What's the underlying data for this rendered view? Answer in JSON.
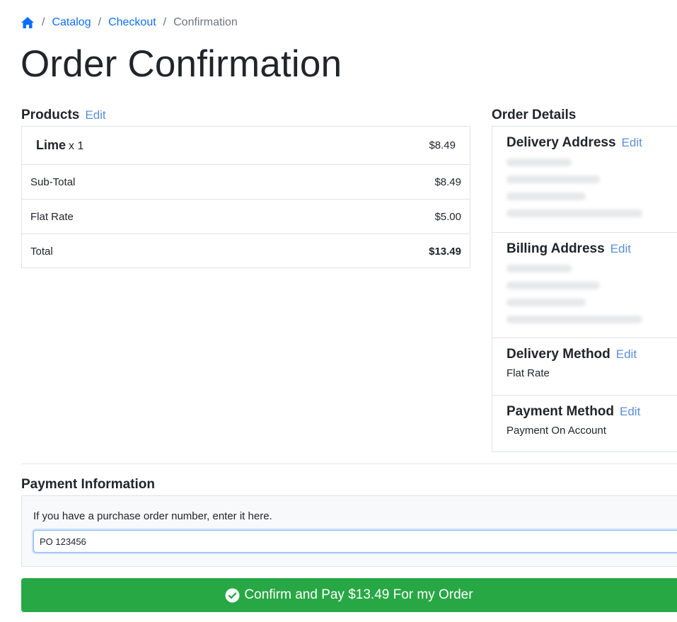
{
  "breadcrumb": {
    "home_icon": "house-icon",
    "separator": "/",
    "items": [
      {
        "label": "Catalog"
      },
      {
        "label": "Checkout"
      },
      {
        "label": "Confirmation"
      }
    ]
  },
  "page_title": "Order Confirmation",
  "products": {
    "heading": "Products",
    "edit_label": "Edit",
    "items": [
      {
        "name": "Lime",
        "qty": "x 1",
        "price": "$8.49"
      }
    ],
    "totals": [
      {
        "label": "Sub-Total",
        "value": "$8.49"
      },
      {
        "label": "Flat Rate",
        "value": "$5.00"
      },
      {
        "label": "Total",
        "value": "$13.49"
      }
    ]
  },
  "order_details": {
    "heading": "Order Details",
    "delivery_address": {
      "title": "Delivery Address",
      "edit_label": "Edit"
    },
    "billing_address": {
      "title": "Billing Address",
      "edit_label": "Edit"
    },
    "delivery_method": {
      "title": "Delivery Method",
      "edit_label": "Edit",
      "value": "Flat Rate"
    },
    "payment_method": {
      "title": "Payment Method",
      "edit_label": "Edit",
      "value": "Payment On Account"
    }
  },
  "payment_info": {
    "heading": "Payment Information",
    "po_label": "If you have a purchase order number, enter it here.",
    "po_value": "PO 123456"
  },
  "confirm_button": {
    "label": "Confirm and Pay $13.49 For my Order",
    "icon": "check-circle-icon"
  },
  "colors": {
    "link": "#0d6efd",
    "edit_link": "#5b8fd6",
    "confirm_green": "#28a745",
    "border": "#dee2e6"
  }
}
